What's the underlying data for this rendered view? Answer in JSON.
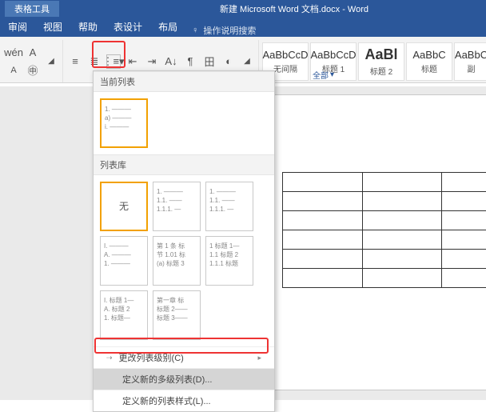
{
  "title": {
    "context": "表格工具",
    "doc": "新建 Microsoft Word 文档.docx - Word"
  },
  "tabs": {
    "review": "审阅",
    "view": "视图",
    "help": "帮助",
    "design": "表设计",
    "layout": "布局",
    "tellme": "操作说明搜索"
  },
  "styles_all": "全部",
  "styles": [
    {
      "prev": "AaBbCcD",
      "name": "无间隔"
    },
    {
      "prev": "AaBbCcD",
      "name": "标题 1"
    },
    {
      "prev": "AaBl",
      "name": "标题 2"
    },
    {
      "prev": "AaBbC",
      "name": "标题"
    },
    {
      "prev": "AaBbC",
      "name": "副"
    }
  ],
  "dd": {
    "sec_current": "当前列表",
    "sec_lib": "列表库",
    "none": "无",
    "thumb_current": [
      "1. ———",
      " a) ———",
      "  i. ———"
    ],
    "lib": [
      [
        "1. ———",
        "  1.1. ——",
        "    1.1.1. —"
      ],
      [
        "1. ———",
        "  1.1. ——",
        "    1.1.1. —"
      ],
      [
        "I. ———",
        "  A. ———",
        "    1. ———"
      ],
      [
        "第 1 条 标",
        "节 1.01 标",
        " (a) 标题 3"
      ],
      [
        "1 标题 1—",
        " 1.1 标题 2",
        "  1.1.1 标题"
      ],
      [
        "I. 标题 1—",
        " A. 标题 2",
        "  1. 标题—"
      ],
      [
        "第一章 标",
        "标题 2——",
        "标题 3——"
      ]
    ],
    "menu_change": "更改列表级别(C)",
    "menu_define": "定义新的多级列表(D)...",
    "menu_style": "定义新的列表样式(L)..."
  }
}
